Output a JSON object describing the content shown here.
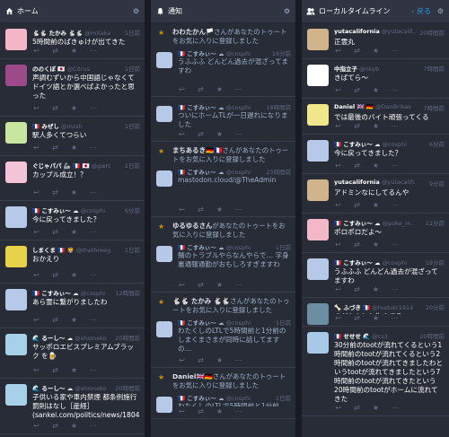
{
  "columns": {
    "home": {
      "title": "ホーム"
    },
    "notifications": {
      "title": "通知"
    },
    "local": {
      "title": "ローカルタイムライン",
      "back": "戻る"
    }
  },
  "home": [
    {
      "name": "🐇🐇 たかみ 🐇🐇",
      "acct": "@mitakami",
      "time": "1日前",
      "text": "5時間前のばきゅけが出てきた",
      "avatar": "#f4b7c8"
    },
    {
      "name": "ののくぼ 🇯🇵",
      "acct": "@Citrus",
      "time": "1日前",
      "text": "声調むずいから中国語じゃなくてドイツ語とか選べばよかったと思った",
      "avatar": "#9c4a8a"
    },
    {
      "name": "🇫🇷 みぜし",
      "acct": "@mzsh",
      "time": "1日前",
      "text": "駅人多くてつらい",
      "avatar": "#c8e6a0"
    },
    {
      "name": "ぐじゃパパ 🦾 🇫🇷 🇯🇵",
      "acct": "@gwrodj",
      "time": "1日前",
      "text": "カップル成立！？",
      "avatar": "#f2c4d6"
    },
    {
      "name": "🇫🇷 こすみぃ～ ☁",
      "acct": "@cosphi",
      "time": "6分前",
      "text": "今に戻ってきました？",
      "avatar": "#b6c9e8"
    },
    {
      "name": "しまくま 🇫🇷 🦁",
      "acct": "@thethreegr",
      "time": "1日前",
      "text": "おかえり",
      "avatar": "#e8d24a"
    },
    {
      "name": "🇫🇷 こすみぃ～ ☁",
      "acct": "@cosphi",
      "time": "12時間前",
      "text": "あら霊に繋がりましたわ",
      "avatar": "#b6c9e8"
    },
    {
      "name": "🌊 るーし～ ☁",
      "acct": "@shioneko",
      "time": "20時間前",
      "text": "サッポロエビスプレミアムブラック を🍺",
      "avatar": "#a8d0e8"
    },
    {
      "name": "🌊 るーし～ ☁",
      "acct": "@shioneko",
      "time": "20時間前",
      "text": "子供いる家や車内禁煙 都条例施行 罰則はなし［産経］(sankei.com/politics/news/18040...",
      "avatar": "#a8d0e8"
    }
  ],
  "notifications": [
    {
      "who": "わわたかん🏳️",
      "what": "さんがあなたのトゥートをお気に入りに登録しました",
      "name": "🇫🇷 こすみぃ～ ☁",
      "acct": "@cosphi",
      "time": "18分前",
      "text": "うふふふ どんどん過去が混ざってますわ"
    },
    {
      "who": "",
      "what": "",
      "name": "🇫🇷 こすみぃ～ ☁",
      "acct": "@cosphi",
      "time": "18時間前",
      "text": "ついにホームTLが一日遅れになりました"
    },
    {
      "who": "まちあるき🇩🇪🇫🇷",
      "what": "さんがあなたのトゥートをお気に入りに登録しました",
      "name": "🇫🇷 こすみぃ～ ☁",
      "acct": "@cosphi",
      "time": "23時間前",
      "text": "mastodon.cloud/@TheAdmin"
    },
    {
      "who": "ゆるゆるさん",
      "what": "があなたのトゥートをお気に入りに登録しました",
      "name": "🇫🇷 こすみぃ～ ☁",
      "acct": "@cosphi",
      "time": "1日前",
      "text": "鯖のトラブルやらなんやらで… 字身裏通報通勤がおもしろすぎますわ"
    },
    {
      "who": "🐇🐇 たかみ 🐇🐇",
      "what": "さんがあなたのトゥートをお気に入りに登録しました",
      "name": "🇫🇷 こすみぃ～ ☁",
      "acct": "@cosphi",
      "time": "1日前",
      "text": "わたくしのLTLで5時間前と1分前のしまくまさまが同時に話してますの…"
    },
    {
      "who": "Daniel🇬🇧🇩🇪",
      "what": "さんがあなたのトゥートをお気に入りに登録しました",
      "name": "🇫🇷 こすみぃ～ ☁",
      "acct": "@cosphi",
      "time": "1日前",
      "text": "わたくしのLTLで5時間前と1分前の…"
    }
  ],
  "local": [
    {
      "name": "yutacalifornia",
      "acct": "@yutacalif...",
      "time": "20時間前",
      "text": "正霊丸",
      "avatar": "#d2b48c"
    },
    {
      "name": "中指立子",
      "acct": "@nkyb",
      "time": "7時間前",
      "text": "きばてら〜",
      "avatar": "#ffffff"
    },
    {
      "name": "Daniel 🇬🇧 🇩🇪",
      "acct": "@DanBrikas",
      "time": "7時間前",
      "text": "では最後のバイト頑張ってくる",
      "avatar": "#f0e68c"
    },
    {
      "name": "🇫🇷 こすみぃ～ ☁",
      "acct": "@cosphi",
      "time": "6分前",
      "text": "今に戻ってきました？",
      "avatar": "#b6c9e8"
    },
    {
      "name": "yutacalifornia",
      "acct": "@yutacalifornia",
      "time": "9分前",
      "text": "アドミンなにしてるんや",
      "avatar": "#d2b48c"
    },
    {
      "name": "🇫🇷 こすみぃ～ ☁",
      "acct": "@poke_m...",
      "time": "11分前",
      "text": "ポロポロだよ～",
      "avatar": "#f4b7c8"
    },
    {
      "name": "🇫🇷 こすみぃ～ ☁",
      "acct": "@cosphi",
      "time": "18分前",
      "text": "うふふふ どんどん過去が混ざってますわ",
      "avatar": "#b6c9e8"
    },
    {
      "name": "🦴 ふづき 🇫🇷",
      "acct": "@hudukr1914",
      "time": "20分前",
      "text": "まだなんとか生きてる",
      "avatar": "#6b8ea3"
    },
    {
      "name": "🇫🇷 せせせ 🌊",
      "acct": "@cs3",
      "time": "20時間前",
      "text": "30分前のtootが流れてくるという1時間前のtootが流れてくるという2時間前のtootが流れてきましたわというtootが流れてきましたという7時間前のtootが流れてきたという20時間前のtootがホームに流れてきた",
      "avatar": "#a8c8e8"
    }
  ],
  "icons": {
    "reply": "↩",
    "boost": "⇄",
    "fav": "★",
    "more": "⋯",
    "settings": "⚙"
  }
}
